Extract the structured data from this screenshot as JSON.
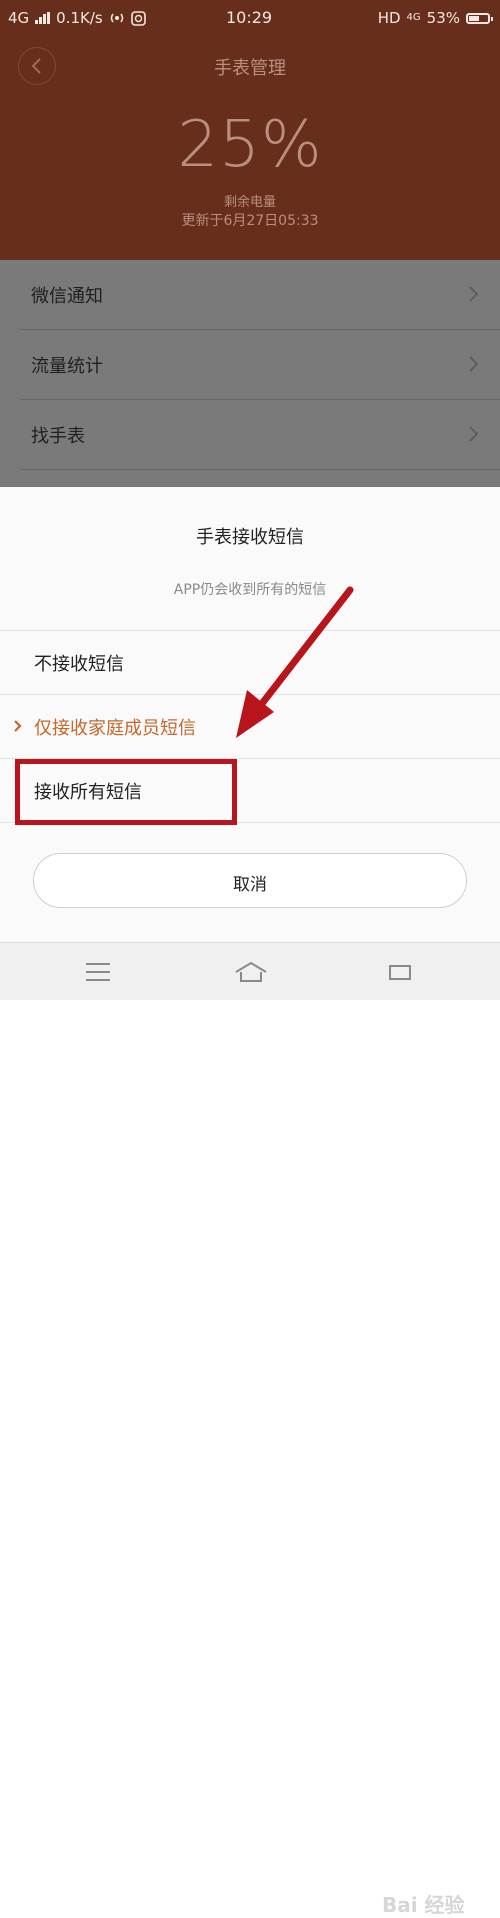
{
  "status_bar": {
    "network": "4G",
    "speed": "0.1K/s",
    "time": "10:29",
    "hd": "HD",
    "network_right": "4G",
    "battery": "53%",
    "battery_level": 0.53
  },
  "header": {
    "title": "手表管理",
    "battery_percent": "25%",
    "battery_label": "剩余电量",
    "updated": "更新于6月27日05:33"
  },
  "list": {
    "items": [
      {
        "label": "微信通知"
      },
      {
        "label": "流量统计"
      },
      {
        "label": "找手表"
      }
    ]
  },
  "sheet": {
    "title": "手表接收短信",
    "subtitle": "APP仍会收到所有的短信",
    "options": [
      {
        "label": "不接收短信",
        "selected": false
      },
      {
        "label": "仅接收家庭成员短信",
        "selected": true
      },
      {
        "label": "接收所有短信",
        "selected": false
      }
    ],
    "cancel": "取消"
  },
  "watermark": "Bai 经验",
  "colors": {
    "header_bg": "#672e1b",
    "selected": "#c5682a",
    "annotation": "#b8141b"
  }
}
